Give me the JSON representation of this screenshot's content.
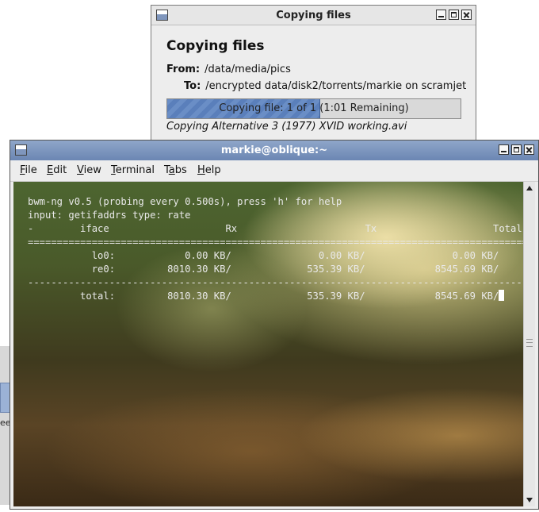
{
  "background_window": {
    "text_fragment": "ee"
  },
  "copy_dialog": {
    "window_title": "Copying files",
    "heading": "Copying files",
    "from_label": "From:",
    "from_value": "/data/media/pics",
    "to_label": "To:",
    "to_value": "/encrypted data/disk2/torrents/markie on scramjet",
    "progress_text": "Copying file: 1 of 1 (1:01 Remaining)",
    "progress_fraction": 0.52,
    "status": "Copying  Alternative 3 (1977) XVID working.avi"
  },
  "terminal": {
    "window_title": "markie@oblique:~",
    "menu": [
      {
        "first": "F",
        "rest": "ile"
      },
      {
        "first": "E",
        "rest": "dit"
      },
      {
        "first": "V",
        "rest": "iew"
      },
      {
        "first": "T",
        "rest": "erminal"
      },
      {
        "first": "Ta",
        "rest": "bs",
        "underline": "b"
      },
      {
        "first": "H",
        "rest": "elp"
      }
    ],
    "output": "bwm-ng v0.5 (probing every 0.500s), press 'h' for help\ninput: getifaddrs type: rate\n-        iface                    Rx                      Tx                    Total\n==========================================================================================\n           lo0:            0.00 KB/               0.00 KB/               0.00 KB/\n           re0:         8010.30 KB/             535.39 KB/            8545.69 KB/\n------------------------------------------------------------------------------------------\n         total:         8010.30 KB/             535.39 KB/            8545.69 KB/"
  },
  "colors": {
    "titlebar_active": "#6b86b3",
    "progress_fill": "#5a7fbb",
    "terminal_text": "#e9e9e9"
  }
}
